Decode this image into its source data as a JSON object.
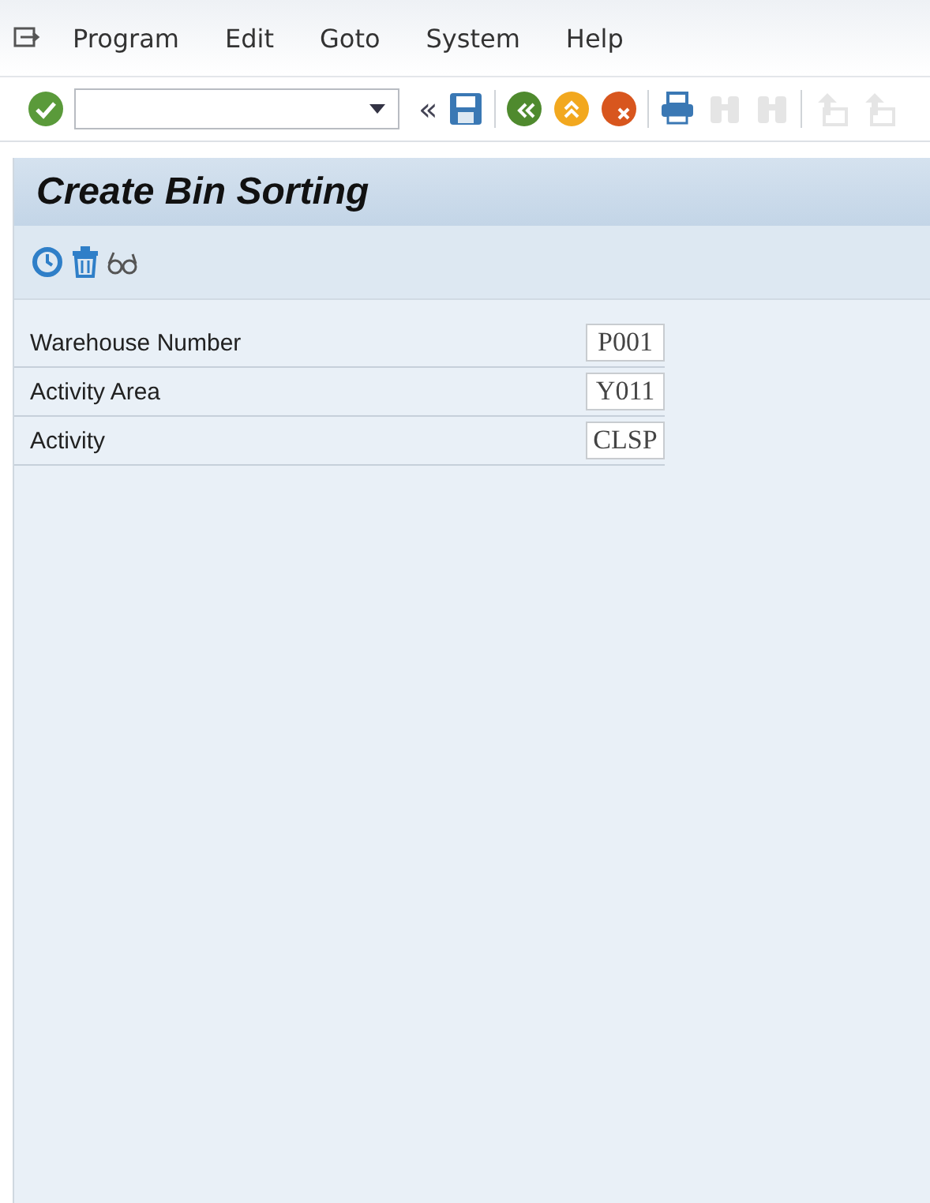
{
  "menu_bar": {
    "items": [
      {
        "label": "Program"
      },
      {
        "label": "Edit"
      },
      {
        "label": "Goto"
      },
      {
        "label": "System"
      },
      {
        "label": "Help"
      }
    ]
  },
  "toolbar": {
    "items": [
      {
        "kind": "enter",
        "disabled": false
      },
      {
        "kind": "command_field"
      },
      {
        "kind": "collapse",
        "glyph": "«"
      },
      {
        "kind": "save",
        "disabled": false
      },
      {
        "kind": "back",
        "disabled": false
      },
      {
        "kind": "exit",
        "disabled": false
      },
      {
        "kind": "cancel",
        "disabled": false
      },
      {
        "kind": "print",
        "disabled": false
      },
      {
        "kind": "find",
        "disabled": true
      },
      {
        "kind": "find_next",
        "disabled": true
      },
      {
        "kind": "first_page",
        "disabled": true
      },
      {
        "kind": "previous_page",
        "disabled": true
      }
    ]
  },
  "title": "Create Bin Sorting",
  "application_toolbar": {
    "items": [
      {
        "kind": "execute"
      },
      {
        "kind": "delete"
      },
      {
        "kind": "display"
      }
    ]
  },
  "fields": [
    {
      "label": "Warehouse Number",
      "value": "P001"
    },
    {
      "label": "Activity Area",
      "value": "Y011"
    },
    {
      "label": "Activity",
      "value": "CLSP"
    }
  ]
}
